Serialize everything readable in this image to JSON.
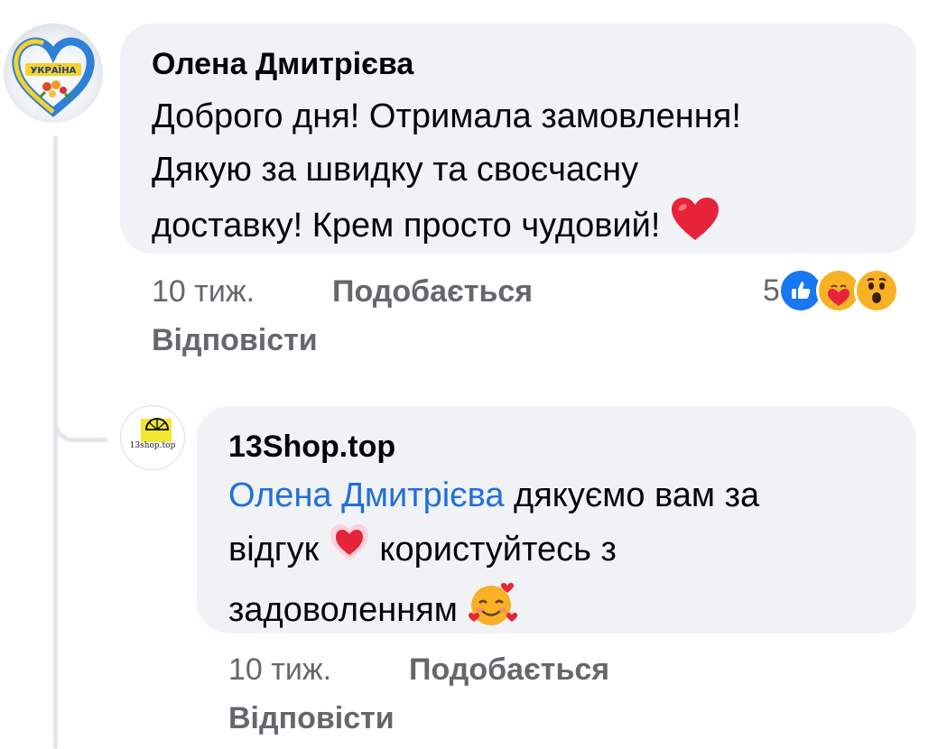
{
  "comment": {
    "author": "Олена Дмитрієва",
    "lines": [
      "Доброго дня! Отримала замовлення!",
      "Дякую за швидку та своєчасну",
      "доставку! Крем просто чудовий!"
    ],
    "time": "10 тиж.",
    "like_label": "Подобається",
    "reply_label": "Відповісти",
    "reaction_count": "5",
    "reactions": [
      "like-icon",
      "care-icon",
      "wow-icon"
    ],
    "avatar_text": "УКРАЇНА"
  },
  "reply": {
    "author": "13Shop.top",
    "mention": "Олена Дмитрієва",
    "text_a": " дякуємо вам за",
    "text_b": "відгук",
    "text_c": " користуйтесь з",
    "text_d": "задоволенням",
    "time": "10 тиж.",
    "like_label": "Подобається",
    "reply_label": "Відповісти",
    "avatar_text": "13shop.top"
  },
  "colors": {
    "bubble": "#f0f2f5",
    "mention": "#216fdb",
    "meta": "#65676b",
    "like_blue": "#1877f2"
  }
}
